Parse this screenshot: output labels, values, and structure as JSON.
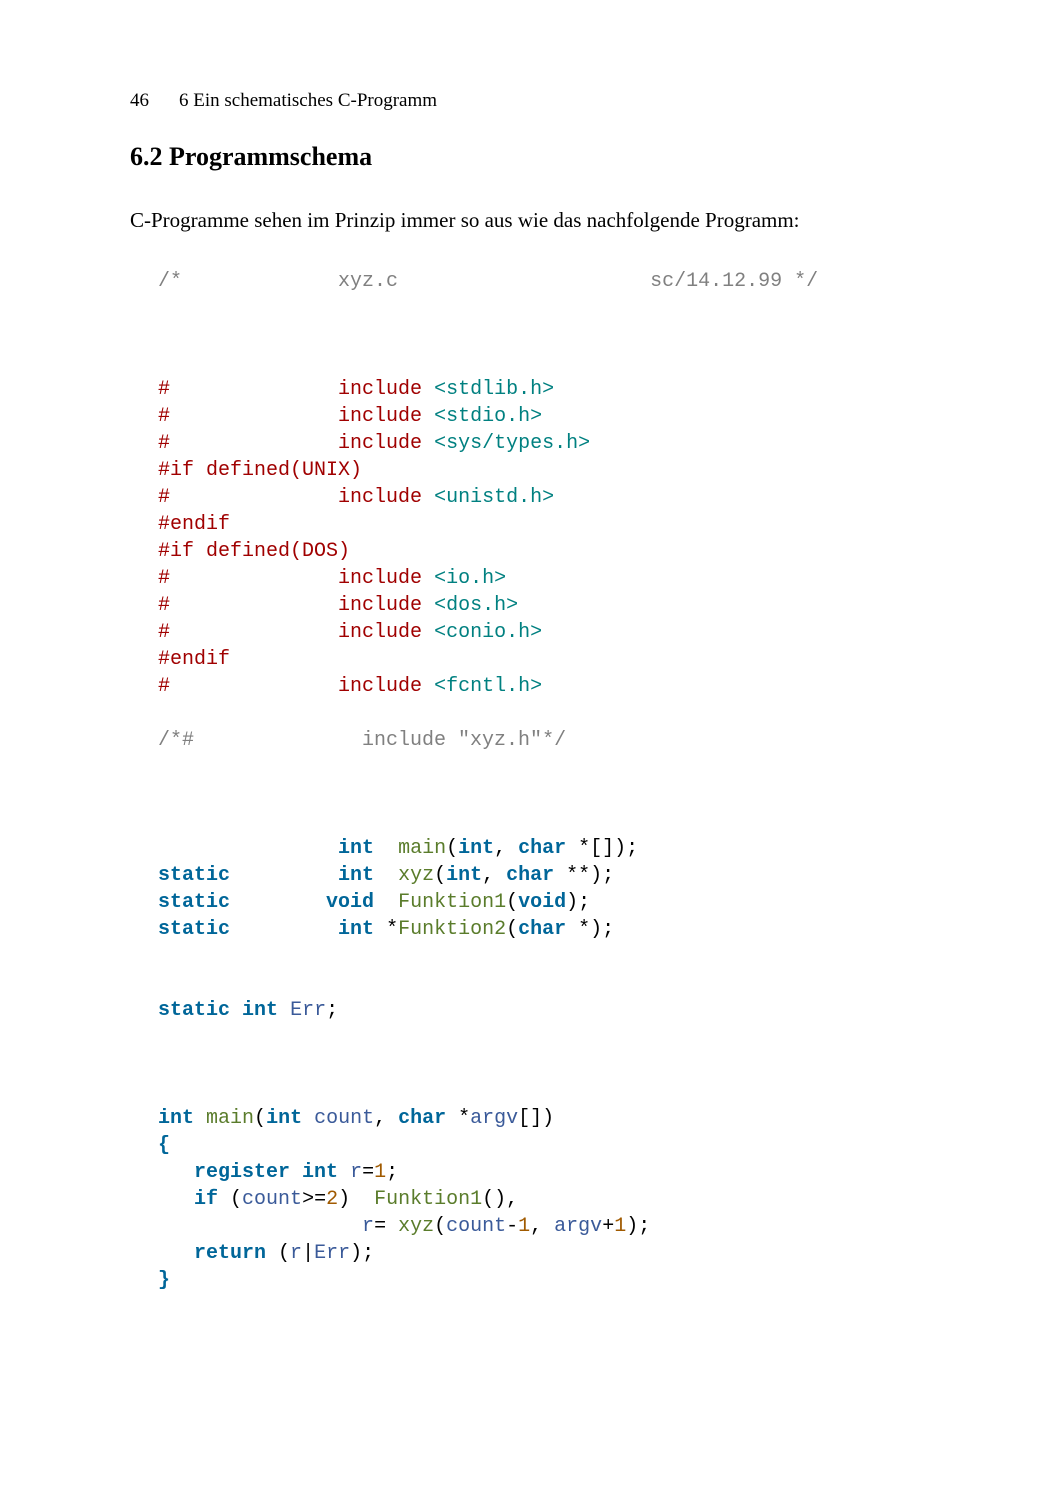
{
  "header": {
    "page_number": "46",
    "chapter_label": "6 Ein schematisches C-Programm"
  },
  "section": {
    "number": "6.2",
    "title": "Programmschema"
  },
  "intro_paragraph": "C-Programme sehen im Prinzip immer so aus wie das nachfolgende Programm:",
  "code": {
    "c1_a": "/*",
    "c1_b": "xyz.c",
    "c1_c": "sc/14.12.99 */",
    "inc1_hash": "#",
    "inc1_kw": "include",
    "inc1_h": "<stdlib.h>",
    "inc2_hash": "#",
    "inc2_kw": "include",
    "inc2_h": "<stdio.h>",
    "inc3_hash": "#",
    "inc3_kw": "include",
    "inc3_h": "<sys/types.h>",
    "ifdef_unix": "#if defined(UNIX)",
    "inc4_hash": "#",
    "inc4_kw": "include",
    "inc4_h": "<unistd.h>",
    "endif1": "#endif",
    "ifdef_dos": "#if defined(DOS)",
    "inc5_hash": "#",
    "inc5_kw": "include",
    "inc5_h": "<io.h>",
    "inc6_hash": "#",
    "inc6_kw": "include",
    "inc6_h": "<dos.h>",
    "inc7_hash": "#",
    "inc7_kw": "include",
    "inc7_h": "<conio.h>",
    "endif2": "#endif",
    "inc8_hash": "#",
    "inc8_kw": "include",
    "inc8_h": "<fcntl.h>",
    "c2": "/*#              include \"xyz.h\"*/",
    "p1_ty1": "int",
    "p1_fn": "main",
    "p1_sig_a": "(",
    "p1_sig_ty1": "int",
    "p1_sig_b": ", ",
    "p1_sig_ty2": "char",
    "p1_sig_c": " *[]);",
    "p2_kw": "static",
    "p2_ty": "int",
    "p2_fn": "xyz",
    "p2_sig_a": "(",
    "p2_sig_ty1": "int",
    "p2_sig_b": ", ",
    "p2_sig_ty2": "char",
    "p2_sig_c": " **);",
    "p3_kw": "static",
    "p3_ty": "void",
    "p3_fn": "Funktion1",
    "p3_sig_a": "(",
    "p3_sig_ty": "void",
    "p3_sig_b": ");",
    "p4_kw": "static",
    "p4_ty": "int",
    "p4_star": " *",
    "p4_fn": "Funktion2",
    "p4_sig_a": "(",
    "p4_sig_ty": "char",
    "p4_sig_b": " *);",
    "g_kw1": "static",
    "g_ty": "int",
    "g_nm": "Err",
    "g_sc": ";",
    "m_ty1": "int",
    "m_fn": "main",
    "m_sig_a": "(",
    "m_sig_ty1": "int",
    "m_sig_nm1": "count",
    "m_sig_b": ", ",
    "m_sig_ty2": "char",
    "m_sig_c": " *",
    "m_sig_nm2": "argv",
    "m_sig_d": "[])",
    "m_brace_o": "{",
    "m_l1_kw1": "register",
    "m_l1_ty": "int",
    "m_l1_nm": "r",
    "m_l1_eq": "=",
    "m_l1_v": "1",
    "m_l1_sc": ";",
    "m_l2_kw": "if",
    "m_l2_a": " (",
    "m_l2_nm": "count",
    "m_l2_op": ">=",
    "m_l2_v": "2",
    "m_l2_b": ")  ",
    "m_l2_fn": "Funktion1",
    "m_l2_c": "(),",
    "m_l3_nm": "r",
    "m_l3_eq": "= ",
    "m_l3_fn": "xyz",
    "m_l3_a": "(",
    "m_l3_nm2": "count",
    "m_l3_b": "-",
    "m_l3_v1": "1",
    "m_l3_c": ", ",
    "m_l3_nm3": "argv",
    "m_l3_d": "+",
    "m_l3_v2": "1",
    "m_l3_e": ");",
    "m_l4_kw": "return",
    "m_l4_a": " (",
    "m_l4_nm1": "r",
    "m_l4_op": "|",
    "m_l4_nm2": "Err",
    "m_l4_b": ");",
    "m_brace_c": "}"
  }
}
